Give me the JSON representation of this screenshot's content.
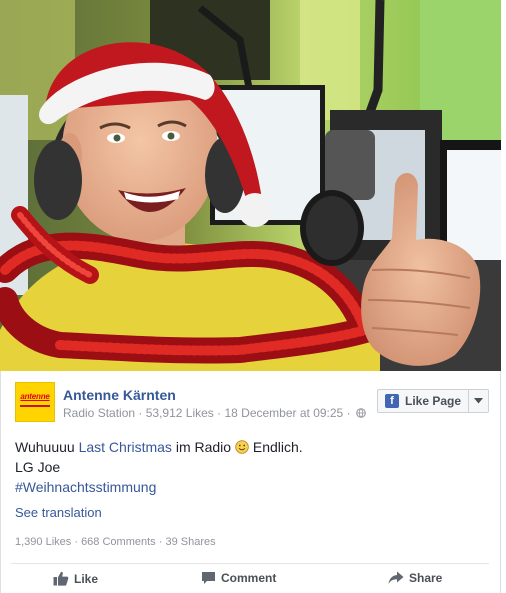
{
  "post": {
    "page_name": "Antenne Kärnten",
    "page_category": "Radio Station",
    "likes_count": "53,912 Likes",
    "timestamp": "18 December at 09:25",
    "separator": "·",
    "like_page_label": "Like Page",
    "logo_text": "antenne",
    "text": {
      "line1_prefix": "Wuhuuuu ",
      "line1_link": "Last Christmas",
      "line1_middle": " im Radio ",
      "line1_suffix": " Endlich.",
      "line2": "LG Joe",
      "hashtag": "#Weihnachtsstimmung"
    },
    "see_translation": "See translation",
    "stats": {
      "likes": "1,390 Likes",
      "comments": "668 Comments",
      "shares": "39 Shares"
    },
    "actions": {
      "like": "Like",
      "comment": "Comment",
      "share": "Share"
    }
  },
  "icons": {
    "page_logo": "antenne-logo",
    "globe": "globe-icon",
    "facebook": "facebook-icon",
    "caret": "chevron-down-icon",
    "emoji": "smiley-icon",
    "like": "thumbs-up-icon",
    "comment": "comment-bubble-icon",
    "share": "share-arrow-icon"
  },
  "colors": {
    "link": "#365899",
    "muted": "#90949c",
    "logo_bg": "#ffd400",
    "fb_blue": "#4267b2"
  }
}
